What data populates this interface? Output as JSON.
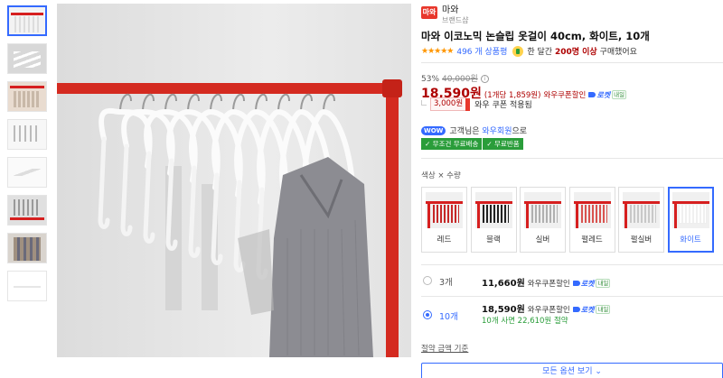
{
  "brand": {
    "logo_text": "마와",
    "name": "마와",
    "sub": "브랜드샵"
  },
  "title": "마와 이코노믹 논슬립 옷걸이 40cm, 화이트, 10개",
  "rating": {
    "stars": "★★★★★",
    "review_count": "496 개 상품평"
  },
  "bought": {
    "prefix": "한 달간 ",
    "count": "200명 이상",
    "suffix": " 구매했어요"
  },
  "discount": {
    "rate": "53%",
    "original": "40,000원",
    "info": "i"
  },
  "price": {
    "value": "18,590원",
    "unit": "(1개당 1,859원)",
    "coupon_label": "와우쿠폰할인",
    "rocket": "로켓",
    "rocket_tag": "내일"
  },
  "coupon": {
    "amount": "3,000원",
    "text": "와우 쿠폰 적용됨"
  },
  "wow": {
    "badge": "WOW",
    "text_prefix": "고객님은 ",
    "link": "와우회원",
    "text_suffix": "으로"
  },
  "free_badges": [
    "✓ 무조건 무료배송",
    "✓ 무료반품"
  ],
  "option_label": "색상 × 수량",
  "colors": [
    {
      "name": "레드",
      "selected": false,
      "hanger_color": "#c62828"
    },
    {
      "name": "블랙",
      "selected": false,
      "hanger_color": "#222222"
    },
    {
      "name": "실버",
      "selected": false,
      "hanger_color": "#b0b0b0"
    },
    {
      "name": "펄레드",
      "selected": false,
      "hanger_color": "#d9534f"
    },
    {
      "name": "펄실버",
      "selected": false,
      "hanger_color": "#c8c8c8"
    },
    {
      "name": "화이트",
      "selected": true,
      "hanger_color": "#ffffff"
    }
  ],
  "quantities": [
    {
      "label": "3개",
      "price": "11,660원",
      "coupon": "와우쿠폰할인",
      "rocket": "로켓",
      "rocket_tag": "내일",
      "save": ""
    },
    {
      "label": "10개",
      "price": "18,590원",
      "coupon": "와우쿠폰할인",
      "rocket": "로켓",
      "rocket_tag": "내일",
      "save": "10개 사면 22,610원 절약"
    }
  ],
  "std_link": "절약 금액 기준",
  "more_button": "모든 옵션 보기 ⌄",
  "colors_theme": {
    "accent": "#346aff",
    "price_red": "#ae0000",
    "rack_red": "#d61f1f",
    "green": "#2a9d3a"
  }
}
